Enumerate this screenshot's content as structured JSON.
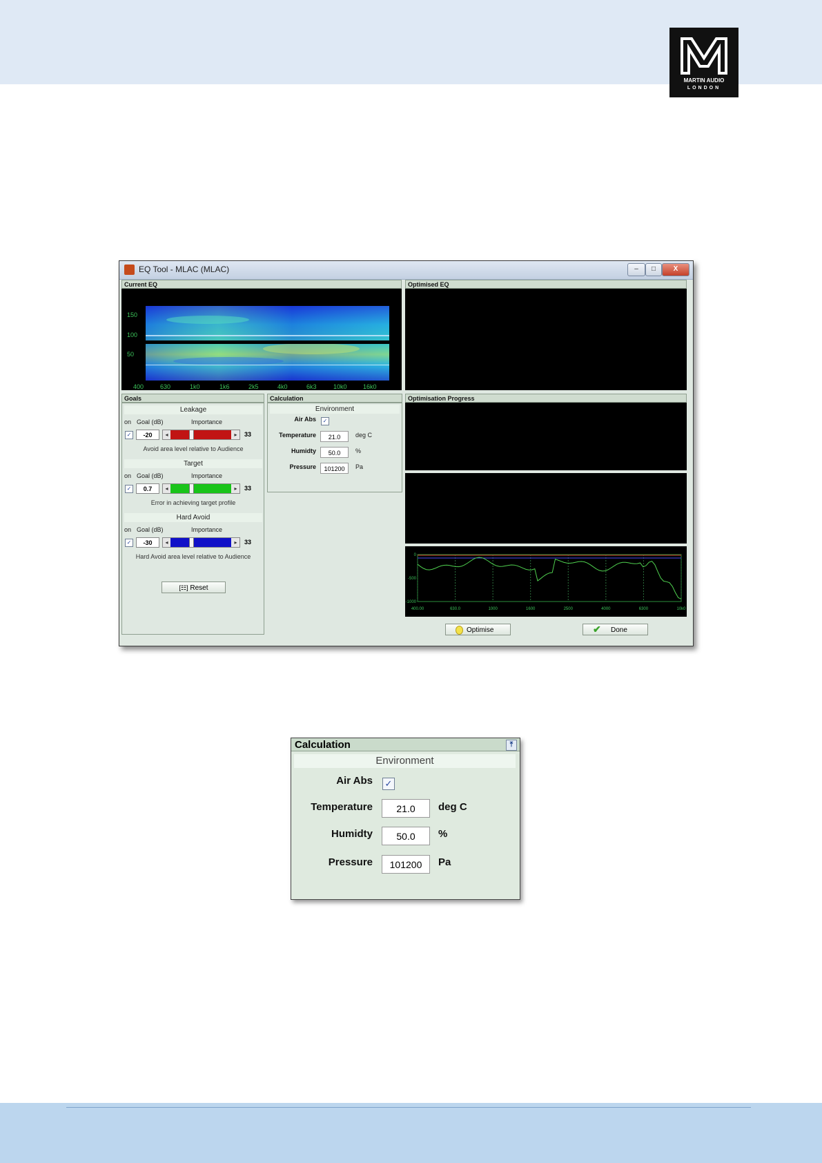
{
  "logo": {
    "line1": "MARTIN AUDIO",
    "line2": "LONDON"
  },
  "window": {
    "title": "EQ Tool - MLAC (MLAC)",
    "controls": {
      "minimize": "–",
      "maximize": "□",
      "close": "X"
    }
  },
  "panels": {
    "current_eq": "Current EQ",
    "optimised_eq": "Optimised EQ",
    "goals": "Goals",
    "calculation": "Calculation",
    "optimisation_progress": "Optimisation Progress"
  },
  "current_eq_axes": {
    "y_ticks": [
      "150",
      "100",
      "50"
    ],
    "x_ticks": [
      "400",
      "630",
      "1k0",
      "1k6",
      "2k5",
      "4k0",
      "6k3",
      "10k0",
      "16k0"
    ]
  },
  "goals": {
    "col_on": "on",
    "col_goal": "Goal (dB)",
    "col_importance": "Importance",
    "sections": [
      {
        "title": "Leakage",
        "enabled": true,
        "goal": "-20",
        "importance": "33",
        "importance_fraction": 0.33,
        "color": "#c11414",
        "description": "Avoid area level relative to Audience"
      },
      {
        "title": "Target",
        "enabled": true,
        "goal": "0.7",
        "importance": "33",
        "importance_fraction": 0.33,
        "color": "#19c419",
        "description": "Error in achieving target profile"
      },
      {
        "title": "Hard Avoid",
        "enabled": true,
        "goal": "-30",
        "importance": "33",
        "importance_fraction": 0.33,
        "color": "#1010c8",
        "description": "Hard Avoid area level relative to Audience"
      }
    ],
    "reset_label": "Reset",
    "reset_icon": "reset-icon"
  },
  "calculation": {
    "environment_label": "Environment",
    "air_abs_label": "Air Abs",
    "air_abs_checked": true,
    "temperature_label": "Temperature",
    "temperature_value": "21.0",
    "temperature_unit": "deg C",
    "humidity_label": "Humidty",
    "humidity_value": "50.0",
    "humidity_unit": "%",
    "pressure_label": "Pressure",
    "pressure_value": "101200",
    "pressure_unit": "Pa"
  },
  "progress_chart": {
    "y_ticks": [
      "0",
      "-500",
      "-1000"
    ],
    "x_ticks": [
      "400.00",
      "630.0",
      "1000",
      "1600",
      "2500",
      "4000",
      "6300",
      "10k0"
    ],
    "colors": {
      "series1": "#4fd14f",
      "series2": "#d03a2a",
      "series3": "#4a4af0"
    }
  },
  "buttons": {
    "optimise_label": "Optimise",
    "optimise_icon": "lightbulb-icon",
    "done_label": "Done",
    "done_icon": "checkmark-icon"
  },
  "zoom_panel": {
    "title": "Calculation",
    "pin_icon": "pin-icon"
  }
}
